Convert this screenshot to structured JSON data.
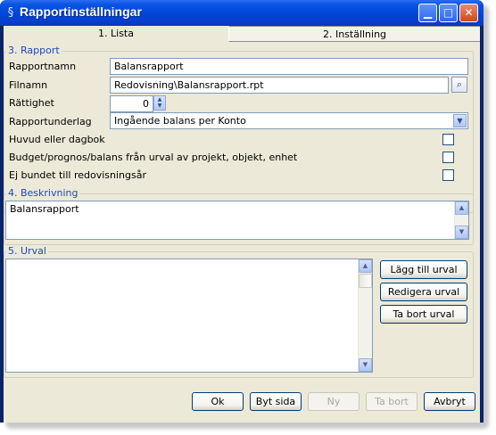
{
  "window": {
    "title": "Rapportinställningar"
  },
  "tabs": [
    {
      "label": "1. Lista"
    },
    {
      "label": "2. Inställning"
    }
  ],
  "rapport": {
    "legend": "3. Rapport",
    "name_label": "Rapportnamn",
    "name_value": "Balansrapport",
    "file_label": "Filnamn",
    "file_value": "Redovisning\\Balansrapport.rpt",
    "rights_label": "Rättighet",
    "rights_value": "0",
    "basis_label": "Rapportunderlag",
    "basis_value": "Ingående balans per Konto",
    "journal_label": "Huvud eller dagbok",
    "budget_label": "Budget/prognos/balans från urval av projekt, objekt, enhet",
    "notbound_label": "Ej bundet till redovisningsår"
  },
  "beskrivning": {
    "legend": "4. Beskrivning",
    "text": "Balansrapport"
  },
  "urval": {
    "legend": "5. Urval",
    "add_label": "Lägg till urval",
    "edit_label": "Redigera urval",
    "remove_label": "Ta bort urval"
  },
  "footer": {
    "ok_label": "Ok",
    "switch_label": "Byt sida",
    "new_label": "Ny",
    "delete_label": "Ta bort",
    "cancel_label": "Avbryt"
  }
}
